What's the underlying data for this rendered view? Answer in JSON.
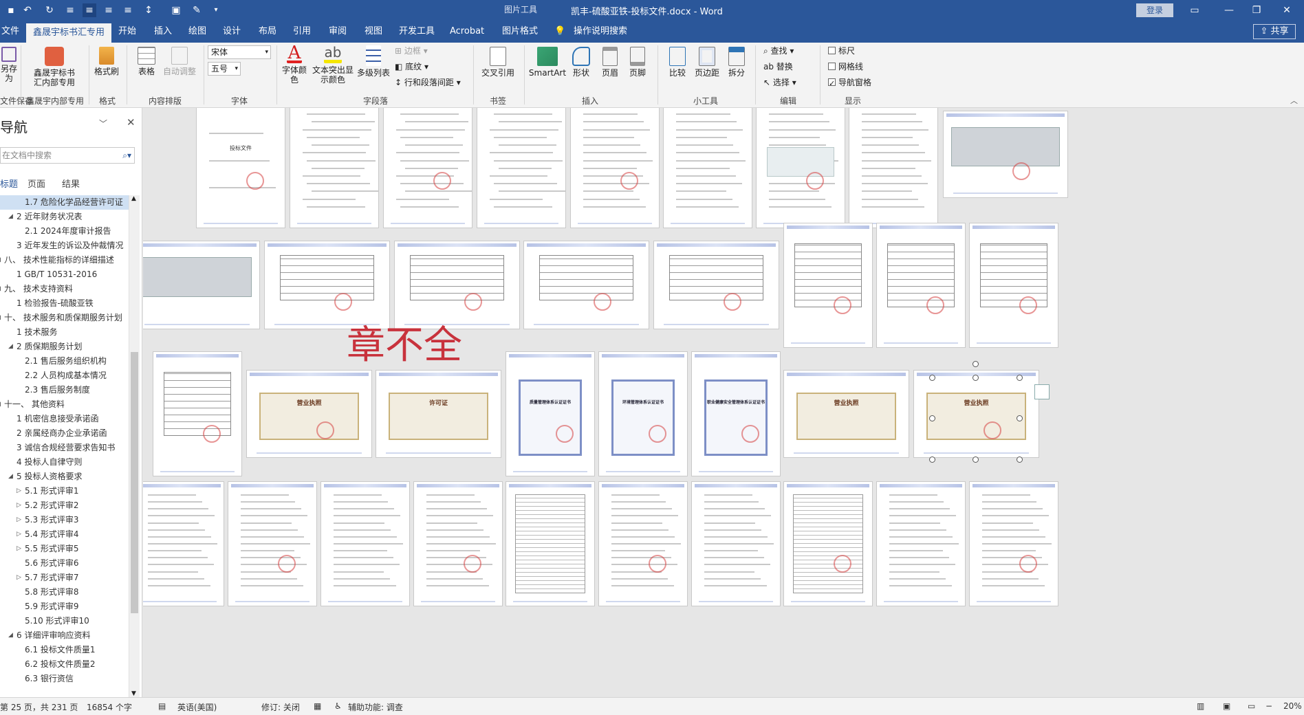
{
  "titlebar": {
    "title": "凯丰-硫酸亚铁-投标文件.docx  -  Word",
    "picture_tools": "图片工具",
    "login": "登录"
  },
  "tabs": {
    "file": "文件",
    "active_tab": "鑫晟宇标书汇专用",
    "items": [
      "开始",
      "插入",
      "绘图",
      "设计",
      "布局",
      "引用",
      "审阅",
      "视图",
      "开发工具",
      "Acrobat",
      "图片格式"
    ],
    "tell_me": "操作说明搜索",
    "share": "共享"
  },
  "ribbon": {
    "save_label": "另存为",
    "save_group": "文件保存",
    "xsy_btn_line1": "鑫晟宇标书",
    "xsy_btn_line2": "汇内部专用",
    "xsy_group": "鑫晟宇内部专用",
    "format_painter": "格式刷",
    "format_group": "格式",
    "table": "表格",
    "auto_adjust": "自动调整",
    "content_group": "内容排版",
    "font_name": "宋体",
    "font_size": "五号",
    "font_group": "字体",
    "font_color_line1": "字体颜",
    "font_color_line2": "色",
    "highlight_line1": "文本突出显",
    "highlight_line2": "示颜色",
    "multilevel": "多级列表",
    "border": "边框",
    "shading": "底纹",
    "line_spacing": "行和段落间距",
    "para_group": "字段落",
    "cross_ref": "交叉引用",
    "bookmark_group": "书签",
    "smartart": "SmartArt",
    "shapes": "形状",
    "header": "页眉",
    "footer": "页脚",
    "insert_group": "插入",
    "compare": "比较",
    "margins": "页边距",
    "split": "拆分",
    "tools_group": "小工具",
    "find": "查找",
    "replace": "替换",
    "select": "选择",
    "edit_group": "编辑",
    "ruler": "标尺",
    "gridlines": "网格线",
    "nav_pane": "导航窗格",
    "show_group": "显示"
  },
  "nav": {
    "title": "导航",
    "search_placeholder": "在文档中搜索",
    "tabs": [
      "标题",
      "页面",
      "结果"
    ],
    "items": [
      {
        "text": "1.7 危险化学品经营许可证",
        "indent": 36,
        "tri": "",
        "sel": true
      },
      {
        "text": "2 近年财务状况表",
        "indent": 24,
        "tri": "◢",
        "sel": false
      },
      {
        "text": "2.1 2024年度审计报告",
        "indent": 36,
        "tri": "",
        "sel": false
      },
      {
        "text": "3 近年发生的诉讼及仲裁情况",
        "indent": 24,
        "tri": "",
        "sel": false
      },
      {
        "text": "八、 技术性能指标的详细描述",
        "indent": 6,
        "tri": "◢",
        "sel": false
      },
      {
        "text": "1 GB/T 10531-2016",
        "indent": 24,
        "tri": "",
        "sel": false
      },
      {
        "text": "九、 技术支持资料",
        "indent": 6,
        "tri": "◢",
        "sel": false
      },
      {
        "text": "1 检验报告-硫酸亚铁",
        "indent": 24,
        "tri": "",
        "sel": false
      },
      {
        "text": "十、 技术服务和质保期服务计划",
        "indent": 6,
        "tri": "◢",
        "sel": false
      },
      {
        "text": "1 技术服务",
        "indent": 24,
        "tri": "",
        "sel": false
      },
      {
        "text": "2 质保期服务计划",
        "indent": 24,
        "tri": "◢",
        "sel": false
      },
      {
        "text": "2.1 售后服务组织机构",
        "indent": 36,
        "tri": "",
        "sel": false
      },
      {
        "text": "2.2 人员构成基本情况",
        "indent": 36,
        "tri": "",
        "sel": false
      },
      {
        "text": "2.3 售后服务制度",
        "indent": 36,
        "tri": "",
        "sel": false
      },
      {
        "text": "十一、 其他资料",
        "indent": 6,
        "tri": "◢",
        "sel": false
      },
      {
        "text": "1 机密信息接受承诺函",
        "indent": 24,
        "tri": "",
        "sel": false
      },
      {
        "text": "2 亲属经商办企业承诺函",
        "indent": 24,
        "tri": "",
        "sel": false
      },
      {
        "text": "3 诚信合规经营要求告知书",
        "indent": 24,
        "tri": "",
        "sel": false
      },
      {
        "text": "4 投标人自律守则",
        "indent": 24,
        "tri": "",
        "sel": false
      },
      {
        "text": "5 投标人资格要求",
        "indent": 24,
        "tri": "◢",
        "sel": false
      },
      {
        "text": "5.1 形式评审1",
        "indent": 36,
        "tri": "▷",
        "sel": false
      },
      {
        "text": "5.2 形式评审2",
        "indent": 36,
        "tri": "▷",
        "sel": false
      },
      {
        "text": "5.3 形式评审3",
        "indent": 36,
        "tri": "▷",
        "sel": false
      },
      {
        "text": "5.4 形式评审4",
        "indent": 36,
        "tri": "▷",
        "sel": false
      },
      {
        "text": "5.5 形式评审5",
        "indent": 36,
        "tri": "▷",
        "sel": false
      },
      {
        "text": "5.6 形式评审6",
        "indent": 36,
        "tri": "",
        "sel": false
      },
      {
        "text": "5.7 形式评审7",
        "indent": 36,
        "tri": "▷",
        "sel": false
      },
      {
        "text": "5.8 形式评审8",
        "indent": 36,
        "tri": "",
        "sel": false
      },
      {
        "text": "5.9 形式评审9",
        "indent": 36,
        "tri": "",
        "sel": false
      },
      {
        "text": "5.10 形式评审10",
        "indent": 36,
        "tri": "",
        "sel": false
      },
      {
        "text": "6 详细评审响应资料",
        "indent": 24,
        "tri": "◢",
        "sel": false
      },
      {
        "text": "6.1 投标文件质量1",
        "indent": 36,
        "tri": "",
        "sel": false
      },
      {
        "text": "6.2 投标文件质量2",
        "indent": 36,
        "tri": "",
        "sel": false
      },
      {
        "text": "6.3 银行资信",
        "indent": 36,
        "tri": "",
        "sel": false
      }
    ]
  },
  "document": {
    "annotation": "章不全",
    "page_cover_title": "投标文件",
    "cert_quality": "质量管理体系认证证书",
    "cert_env": "环境管理体系认证证书",
    "cert_ohs": "职业健康安全管理体系认证证书",
    "license": "营业执照",
    "permit": "许可证"
  },
  "statusbar": {
    "page_info": "第 25 页，共 231 页",
    "word_count": "16854 个字",
    "language": "英语(美国)",
    "track_changes": "修订: 关闭",
    "accessibility": "辅助功能: 调查",
    "zoom": "20%"
  },
  "colors": {
    "word_blue": "#2b579a",
    "ribbon_bg": "#f3f3f3",
    "annotation_red": "#c8323c"
  }
}
